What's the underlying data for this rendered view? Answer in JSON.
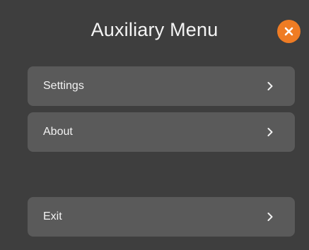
{
  "menu": {
    "title": "Auxiliary Menu",
    "items": [
      {
        "label": "Settings",
        "icon": "chevron-right-icon"
      },
      {
        "label": "About",
        "icon": "chevron-right-icon"
      },
      {
        "label": "Exit",
        "icon": "chevron-right-icon"
      }
    ],
    "close_icon": "close-icon"
  },
  "colors": {
    "background": "#3e3e3e",
    "item_background": "#5a5a5a",
    "close_button": "#ef7c24",
    "text": "#f2f2f2"
  }
}
